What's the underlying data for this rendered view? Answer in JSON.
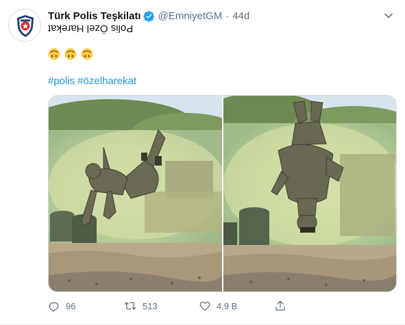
{
  "author": {
    "display_name": "Türk Polis Teşkilatı",
    "handle": "@EmniyetGM",
    "separator": "·",
    "time": "44d",
    "avatar_label": "POLİS"
  },
  "tweet": {
    "flipped_text": "Polis Özel Harekat",
    "emoji_icons": [
      "upside-down-face-icon",
      "upside-down-face-icon",
      "upside-down-face-icon"
    ],
    "hashtags": [
      "#polis",
      "#özelharekat"
    ]
  },
  "media": {
    "photos": [
      {
        "alt": "police special forces officer doing a backflip near smoke"
      },
      {
        "alt": "police special forces officer upside down mid flip"
      }
    ]
  },
  "actions": {
    "reply_count": "96",
    "retweet_count": "513",
    "like_count": "4,9 B",
    "share_count": ""
  },
  "colors": {
    "link": "#1b95e0",
    "muted": "#5b7083",
    "verified": "#1da1f2"
  }
}
